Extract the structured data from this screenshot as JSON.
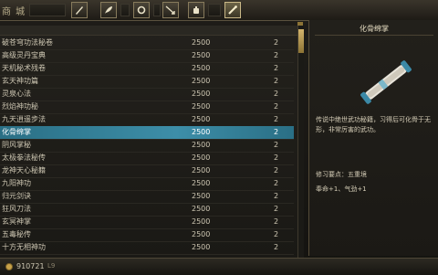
{
  "window": {
    "title": "商 城"
  },
  "tabs": [
    {
      "icon": "brush-icon",
      "active": false
    },
    {
      "icon": "feather-icon",
      "active": false
    },
    {
      "icon": "ring-icon",
      "active": false
    },
    {
      "icon": "spear-icon",
      "active": false
    },
    {
      "icon": "potion-icon",
      "active": false
    },
    {
      "icon": "scroll-icon",
      "active": true
    }
  ],
  "list": {
    "rows": [
      {
        "name": "破苍穹功法秘卷",
        "price": "2500",
        "qty": "2"
      },
      {
        "name": "高级灵丹宝典",
        "price": "2500",
        "qty": "2"
      },
      {
        "name": "天机秘术残卷",
        "price": "2500",
        "qty": "2"
      },
      {
        "name": "玄天神功篇",
        "price": "2500",
        "qty": "2"
      },
      {
        "name": "灵泉心法",
        "price": "2500",
        "qty": "2"
      },
      {
        "name": "烈焰神功秘",
        "price": "2500",
        "qty": "2"
      },
      {
        "name": "九天逍遥步法",
        "price": "2500",
        "qty": "2"
      },
      {
        "name": "化骨绵掌",
        "price": "2500",
        "qty": "2",
        "selected": true
      },
      {
        "name": "阴风掌秘",
        "price": "2500",
        "qty": "2"
      },
      {
        "name": "太极拳法秘传",
        "price": "2500",
        "qty": "2"
      },
      {
        "name": "龙神天心秘籍",
        "price": "2500",
        "qty": "2"
      },
      {
        "name": "九阳神功",
        "price": "2500",
        "qty": "2"
      },
      {
        "name": "归元剑诀",
        "price": "2500",
        "qty": "2"
      },
      {
        "name": "狂风刀法",
        "price": "2500",
        "qty": "2"
      },
      {
        "name": "玄冥神掌",
        "price": "2500",
        "qty": "2"
      },
      {
        "name": "五毒秘传",
        "price": "2500",
        "qty": "2"
      },
      {
        "name": "十方无相神功",
        "price": "2500",
        "qty": "2"
      }
    ]
  },
  "detail": {
    "title": "化骨绵掌",
    "item_icon": "scroll-icon",
    "description": "传说中绝世武功秘籍，习得后可化骨于无形，非常厉害的武功。",
    "stat1": "修习要点：五重境",
    "stat2": "奉命+1、气劲+1"
  },
  "footer": {
    "money": "910721",
    "tag": "L9"
  }
}
